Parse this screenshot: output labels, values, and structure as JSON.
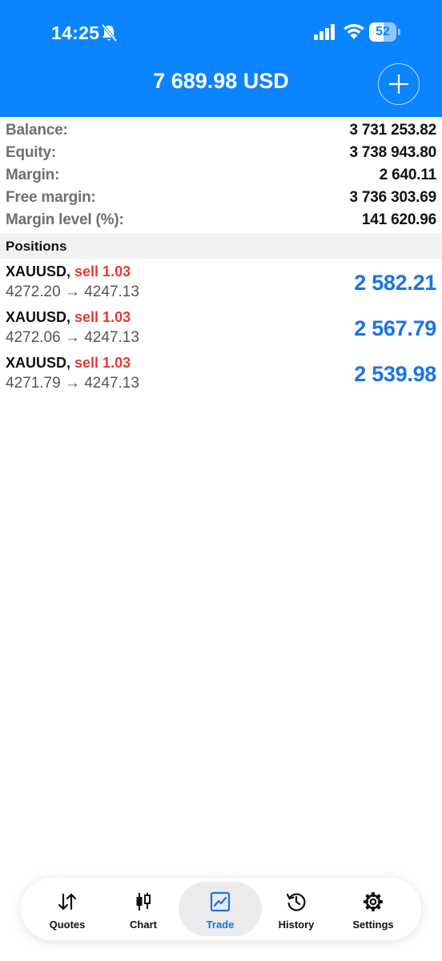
{
  "status_bar": {
    "time": "14:25",
    "battery_level": "52",
    "battery_fraction": 0.52
  },
  "header": {
    "title": "7 689.98 USD",
    "accent_color": "#0a84ff"
  },
  "summary": [
    {
      "label": "Balance:",
      "value": "3 731 253.82"
    },
    {
      "label": "Equity:",
      "value": "3 738 943.80"
    },
    {
      "label": "Margin:",
      "value": "2 640.11"
    },
    {
      "label": "Free margin:",
      "value": "3 736 303.69"
    },
    {
      "label": "Margin level (%):",
      "value": "141 620.96"
    }
  ],
  "positions": {
    "header": "Positions",
    "items": [
      {
        "symbol": "XAUUSD,",
        "side": "sell 1.03",
        "prices": "4272.20 → 4247.13",
        "profit": "2 582.21"
      },
      {
        "symbol": "XAUUSD,",
        "side": "sell 1.03",
        "prices": "4272.06 → 4247.13",
        "profit": "2 567.79"
      },
      {
        "symbol": "XAUUSD,",
        "side": "sell 1.03",
        "prices": "4271.79 → 4247.13",
        "profit": "2 539.98"
      }
    ]
  },
  "tabs": [
    {
      "label": "Quotes",
      "icon": "quotes-icon"
    },
    {
      "label": "Chart",
      "icon": "chart-icon"
    },
    {
      "label": "Trade",
      "icon": "trade-icon",
      "active": true
    },
    {
      "label": "History",
      "icon": "history-icon"
    },
    {
      "label": "Settings",
      "icon": "settings-icon"
    }
  ],
  "colors": {
    "sell": "#e53935",
    "profit": "#1a73e8"
  }
}
